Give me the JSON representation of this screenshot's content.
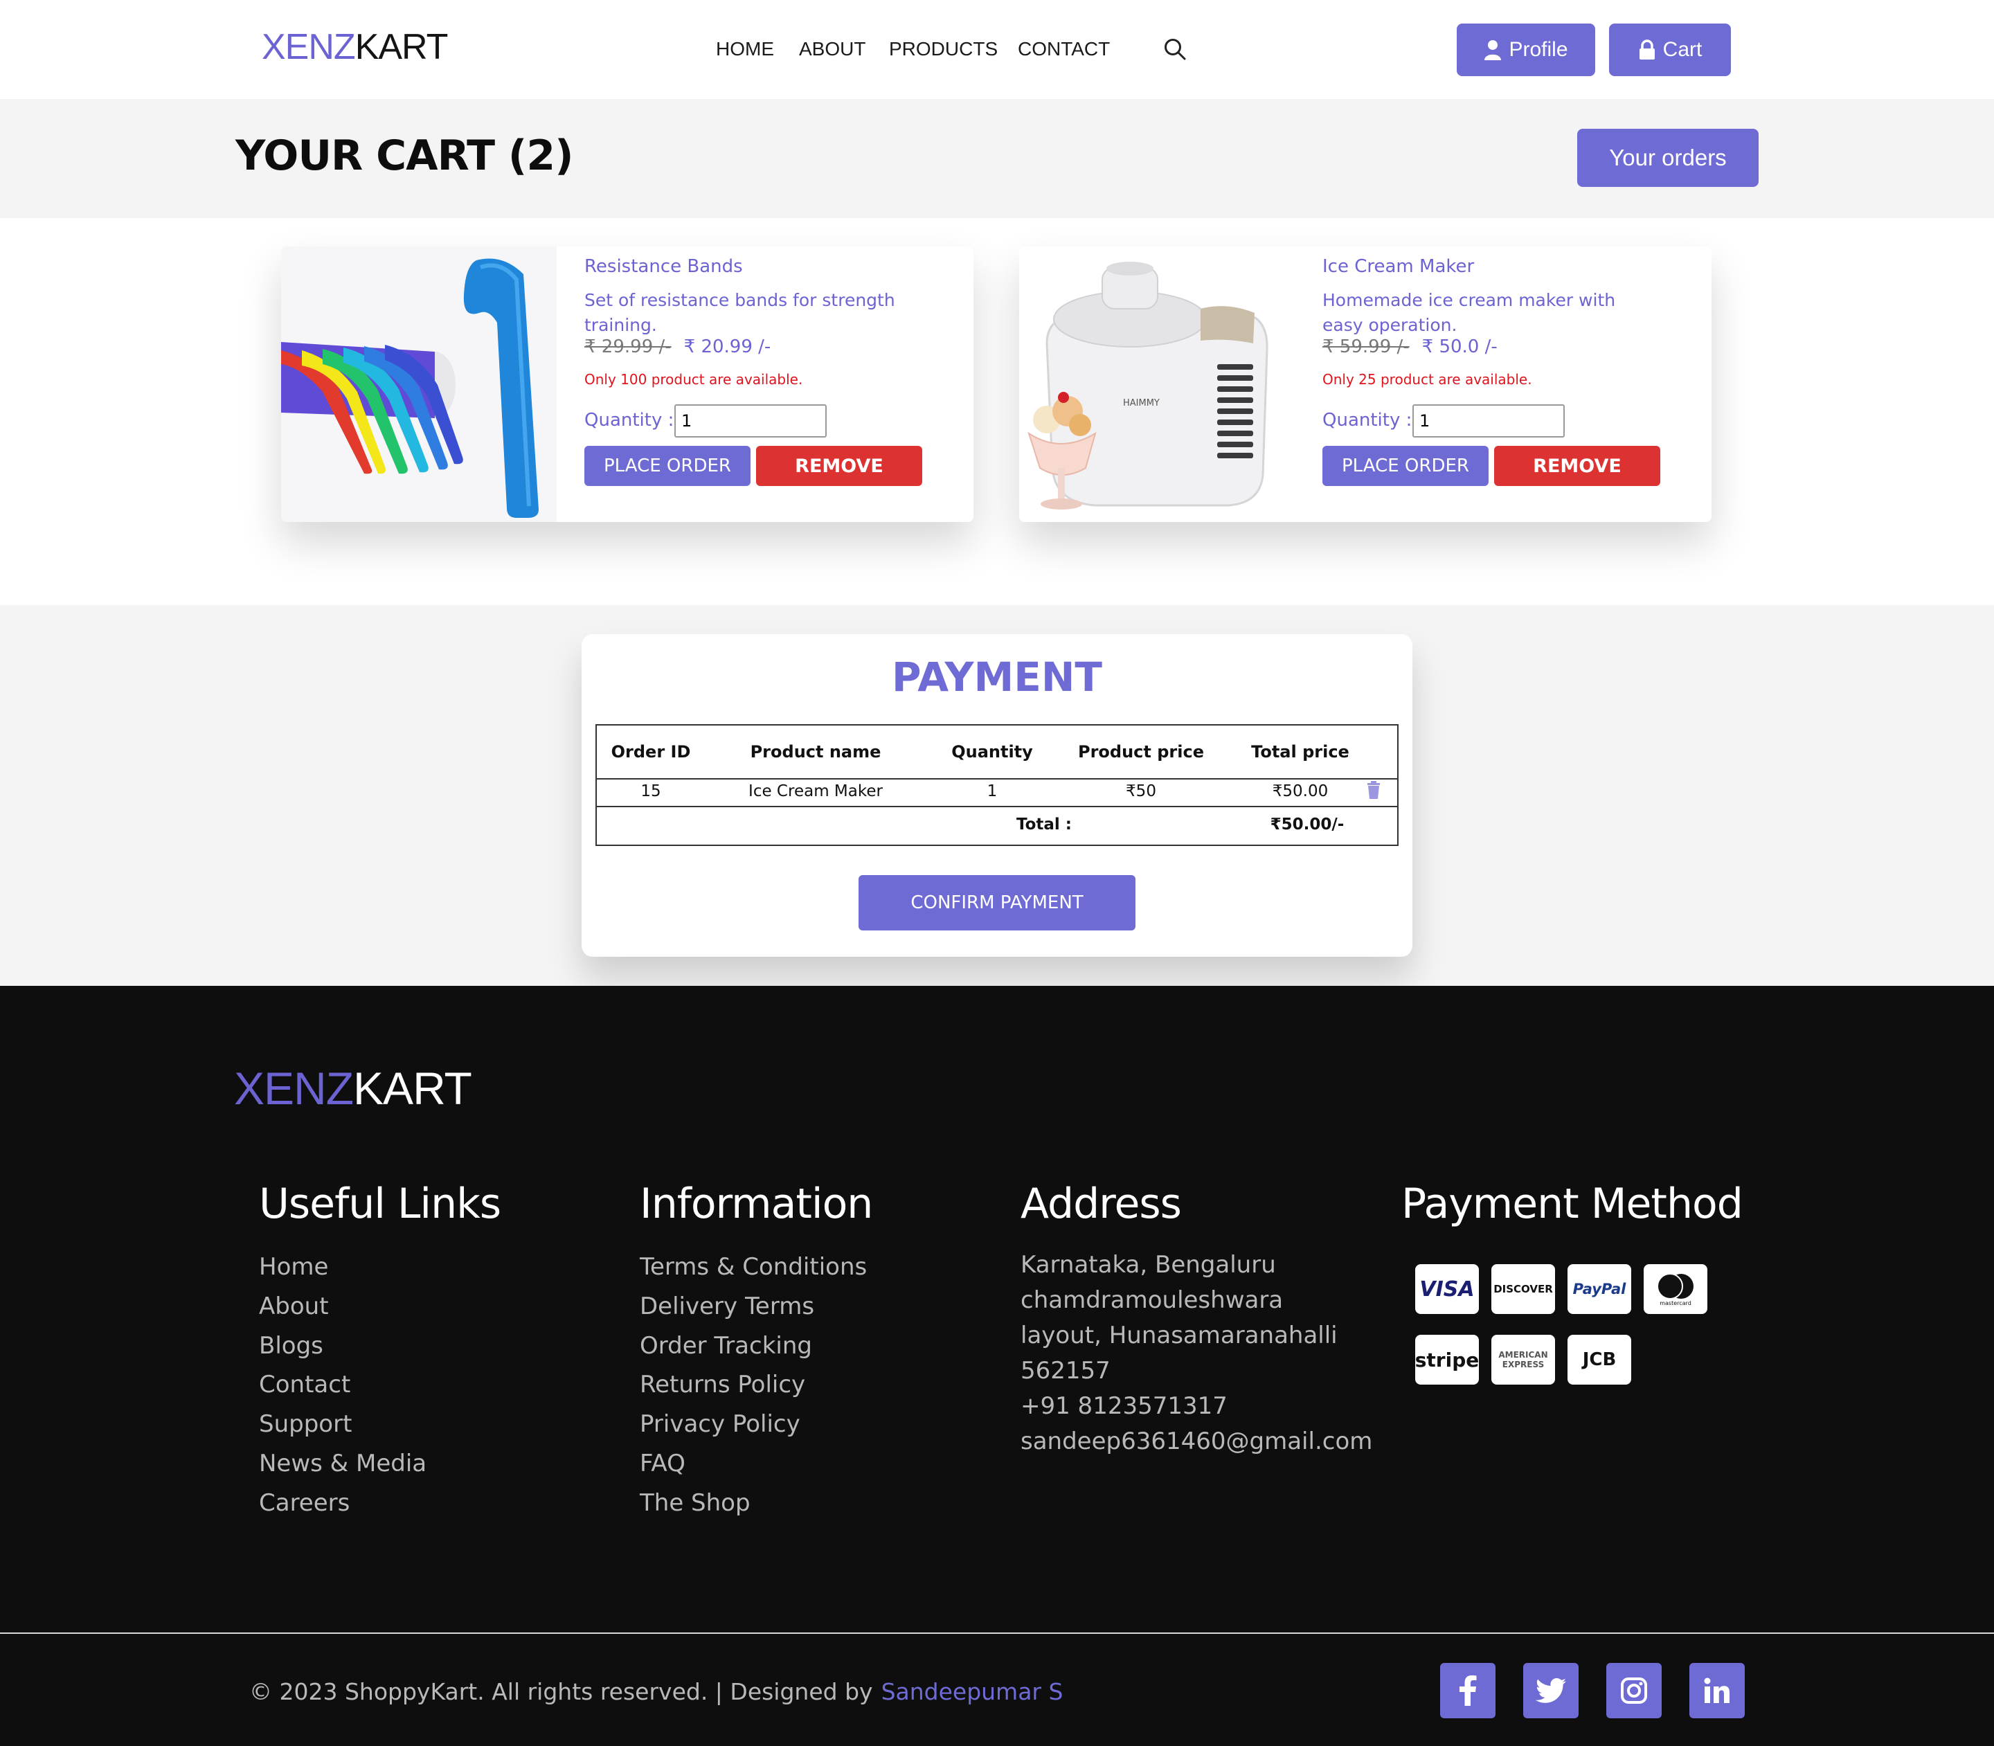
{
  "brand": {
    "part1": "XENZ",
    "part2": "KART"
  },
  "nav": {
    "home": "HOME",
    "about": "ABOUT",
    "products": "PRODUCTS",
    "contact": "CONTACT"
  },
  "header_buttons": {
    "profile": "Profile",
    "cart": "Cart"
  },
  "cart": {
    "title": "YOUR CART (2)",
    "orders_button": "Your orders"
  },
  "products": [
    {
      "name": "Resistance Bands",
      "description": "Set of resistance bands for strength training.",
      "old_price": "₹ 29.99 /-",
      "price": "₹ 20.99 /-",
      "stock": "Only 100 product are available.",
      "quantity_label": "Quantity :",
      "quantity": "1",
      "place_order": "PLACE ORDER",
      "remove": "REMOVE"
    },
    {
      "name": "Ice Cream Maker",
      "description": "Homemade ice cream maker with easy operation.",
      "old_price": "₹ 59.99 /-",
      "price": "₹ 50.0 /-",
      "stock": "Only 25 product are available.",
      "quantity_label": "Quantity :",
      "quantity": "1",
      "place_order": "PLACE ORDER",
      "remove": "REMOVE",
      "image_label": "HAIMMY"
    }
  ],
  "payment": {
    "title": "PAYMENT",
    "headers": [
      "Order ID",
      "Product name",
      "Quantity",
      "Product price",
      "Total price"
    ],
    "rows": [
      {
        "order_id": "15",
        "product_name": "Ice Cream Maker",
        "quantity": "1",
        "product_price": "₹50",
        "total_price": "₹50.00"
      }
    ],
    "total_label": "Total :",
    "total_value": "₹50.00/-",
    "confirm": "CONFIRM PAYMENT"
  },
  "footer": {
    "useful_links": {
      "title": "Useful Links",
      "items": [
        "Home",
        "About",
        "Blogs",
        "Contact",
        "Support",
        "News & Media",
        "Careers"
      ]
    },
    "information": {
      "title": "Information",
      "items": [
        "Terms & Conditions",
        "Delivery Terms",
        "Order Tracking",
        "Returns Policy",
        "Privacy Policy",
        "FAQ",
        "The Shop"
      ]
    },
    "address": {
      "title": "Address",
      "lines": [
        "Karnataka, Bengaluru",
        "chamdramouleshwara",
        "layout, Hunasamaranahalli",
        "562157",
        "+91 8123571317",
        "sandeep6361460@gmail.com"
      ]
    },
    "payment_method": {
      "title": "Payment Method",
      "cards": [
        "VISA",
        "DISCOVER",
        "PayPal",
        "mastercard",
        "stripe",
        "AMERICAN EXPRESS",
        "JCB"
      ]
    },
    "copyright": "© 2023 ShoppyKart. All rights reserved. | Designed by",
    "designer": "Sandeepumar S",
    "social": [
      "facebook-icon",
      "twitter-icon",
      "instagram-icon",
      "linkedin-icon"
    ]
  },
  "colors": {
    "accent": "#6f6bd5",
    "danger": "#dc3332",
    "stock_text": "#e0141c",
    "footer_bg": "#0e0e0e"
  }
}
